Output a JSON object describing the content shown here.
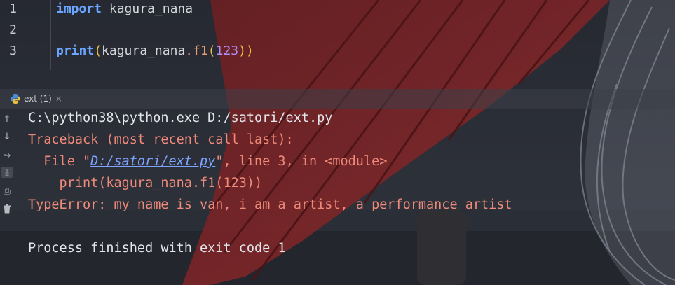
{
  "editor": {
    "lines": [
      {
        "number": "1",
        "keyword": "import",
        "module": "kagura_nana"
      },
      {
        "number": "2"
      },
      {
        "number": "3",
        "func": "print",
        "open_paren": "(",
        "object": "kagura_nana",
        "dot": ".",
        "attr": "f1",
        "open_paren2": "(",
        "arg": "123",
        "close_parens": "))"
      }
    ]
  },
  "run_tab": {
    "label": "ext (1)",
    "close_glyph": "×",
    "icon": "python-icon"
  },
  "side_toolbar": [
    {
      "icon": "up-arrow-icon",
      "glyph": "↑"
    },
    {
      "icon": "down-arrow-icon",
      "glyph": "↓"
    },
    {
      "icon": "soft-wrap-icon",
      "glyph": "⥱"
    },
    {
      "icon": "scroll-to-end-icon",
      "glyph": "⤓"
    },
    {
      "icon": "print-icon",
      "glyph": "⎙"
    },
    {
      "icon": "trash-icon",
      "glyph": "🗑"
    }
  ],
  "console": {
    "command": "C:\\python38\\python.exe D:/satori/ext.py",
    "traceback_header": "Traceback (most recent call last):",
    "file_prefix": "  File \"",
    "file_link": "D:/satori/ext.py",
    "file_suffix": "\", line 3, in <module>",
    "code_echo": "    print(kagura_nana.f1(123))",
    "error": "TypeError: my name is van, i am a artist, a performance artist",
    "exit_message": "Process finished with exit code 1"
  },
  "colors": {
    "stdout": "#e3e5ea",
    "stderr": "#f08a7a",
    "link": "#7ea4ff",
    "keyword": "#6aa6ff"
  }
}
